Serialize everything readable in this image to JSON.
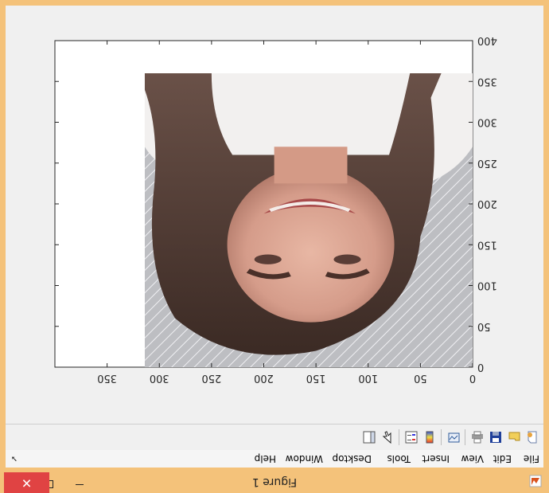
{
  "window": {
    "title": "Figure 1",
    "close_glyph": "✕"
  },
  "menubar": {
    "items": [
      "File",
      "Edit",
      "View",
      "Insert",
      "Tools",
      "Desktop",
      "Window",
      "Help"
    ]
  },
  "toolbar": {
    "buttons": [
      "new-figure-icon",
      "open-file-icon",
      "save-icon",
      "print-icon",
      "link-plot-icon",
      "colorbar-icon",
      "legend-icon",
      "edit-plot-icon",
      "plot-browser-icon"
    ]
  },
  "axes": {
    "x_ticks": [
      "0",
      "50",
      "100",
      "150",
      "200",
      "250",
      "300",
      "350"
    ],
    "y_ticks": [
      "0",
      "50",
      "100",
      "150",
      "200",
      "250",
      "300",
      "350",
      "400"
    ],
    "x_range": [
      0,
      400
    ],
    "y_range": [
      0,
      400
    ],
    "image_extent": {
      "width": 314,
      "height": 360
    }
  },
  "colors": {
    "frame": "#f4c27a",
    "close_button": "#e04343"
  }
}
